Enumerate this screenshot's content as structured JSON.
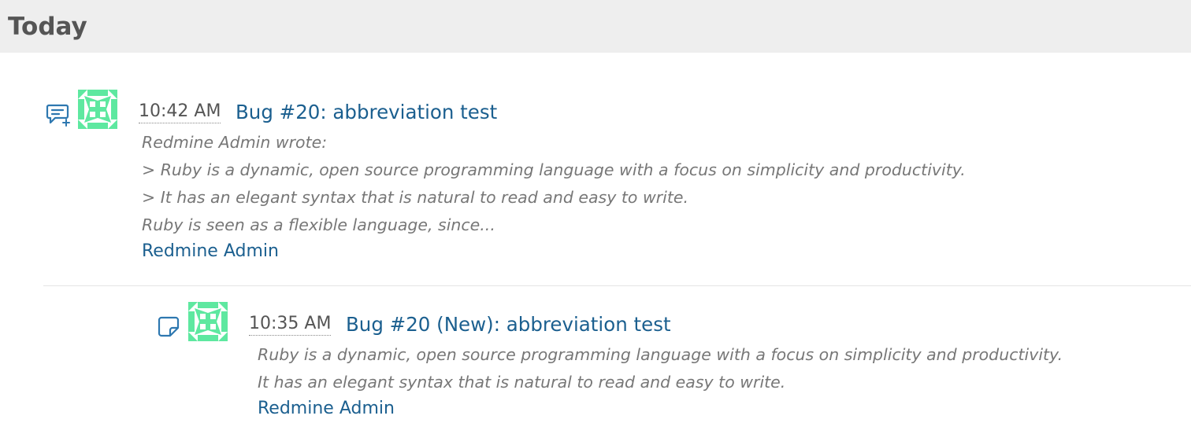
{
  "day": {
    "title": "Today"
  },
  "events": [
    {
      "type_icon": "comment-add-icon",
      "avatar_icon": "identicon-avatar-icon",
      "time": "10:42 AM",
      "title": "Bug #20: abbreviation test",
      "description_lines": [
        "Redmine Admin wrote:",
        "> Ruby is a dynamic, open source programming language with a focus on simplicity and productivity.",
        "> It has an elegant syntax that is natural to read and easy to write.",
        "Ruby is seen as a flexible language, since..."
      ],
      "author": "Redmine Admin"
    },
    {
      "type_icon": "sticky-note-icon",
      "avatar_icon": "identicon-avatar-icon",
      "time": "10:35 AM",
      "title": "Bug #20 (New): abbreviation test",
      "description_lines": [
        "Ruby is a dynamic, open source programming language with a focus on simplicity and productivity.",
        "It has an elegant syntax that is natural to read and easy to write."
      ],
      "author": "Redmine Admin"
    }
  ],
  "colors": {
    "header_bg": "#eeeeee",
    "link": "#1b5f8f",
    "icon": "#2e78b0",
    "avatar": "#5ee8a0",
    "muted_text": "#777777"
  }
}
